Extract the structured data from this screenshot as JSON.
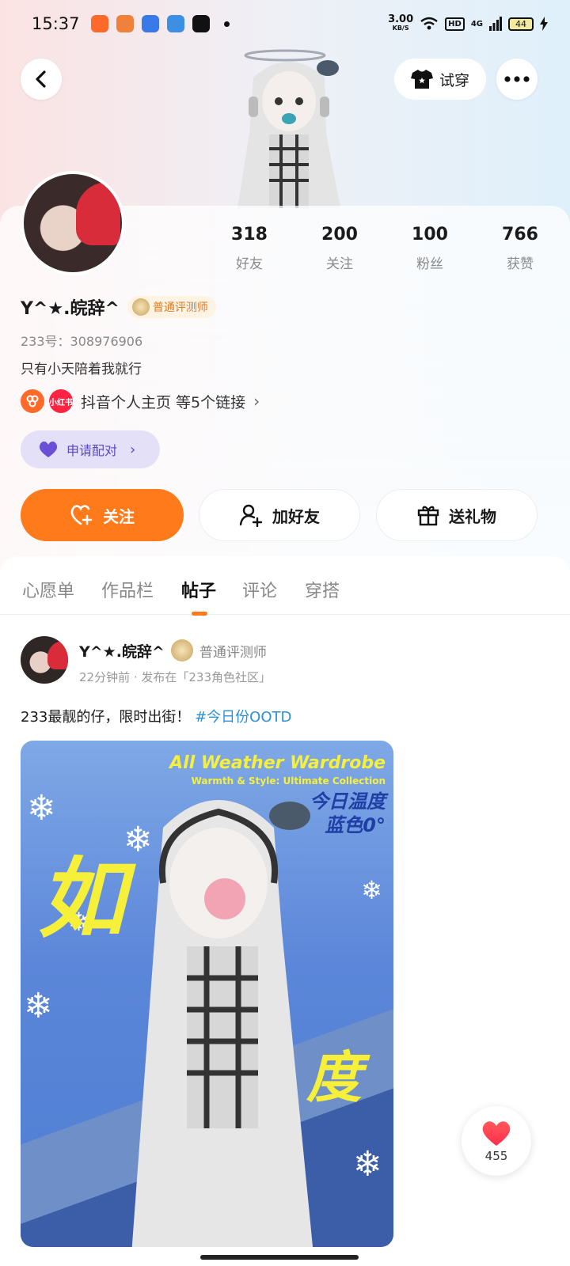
{
  "status": {
    "time": "15:37",
    "net_speed": "3.00",
    "net_unit": "KB/S",
    "hd": "HD",
    "signal": "4G",
    "battery": "44"
  },
  "header": {
    "try_on_label": "试穿"
  },
  "profile": {
    "stats": [
      {
        "num": "318",
        "label": "好友"
      },
      {
        "num": "200",
        "label": "关注"
      },
      {
        "num": "100",
        "label": "粉丝"
      },
      {
        "num": "766",
        "label": "获赞"
      }
    ],
    "nickname": "Y^★.皖辞^",
    "badge": "普通评测师",
    "uid": "233号：308976906",
    "bio": "只有小天陪着我就行",
    "links_icon_b": "小红书",
    "links_text": "抖音个人主页 等5个链接",
    "match_label": "申请配对"
  },
  "actions": {
    "follow": "关注",
    "add_friend": "加好友",
    "send_gift": "送礼物"
  },
  "tabs": [
    "心愿单",
    "作品栏",
    "帖子",
    "评论",
    "穿搭"
  ],
  "active_tab": "帖子",
  "post": {
    "author": "Y^★.皖辞^",
    "badge": "普通评测师",
    "meta": "22分钟前 · 发布在「233角色社区」",
    "text": "233最靓的仔，限时出街！",
    "hashtag": "#今日份OOTD",
    "image": {
      "title": "All Weather Wardrobe",
      "subtitle": "Warmth & Style: Ultimate Collection",
      "temp_line1": "今日温度",
      "temp_line2": "蓝色0°",
      "big1": "如",
      "big2": "度"
    }
  },
  "like": {
    "count": "455"
  },
  "colors": {
    "accent": "#ff7a1a",
    "hashtag": "#2b8fd6",
    "match": "#5b46c9"
  }
}
